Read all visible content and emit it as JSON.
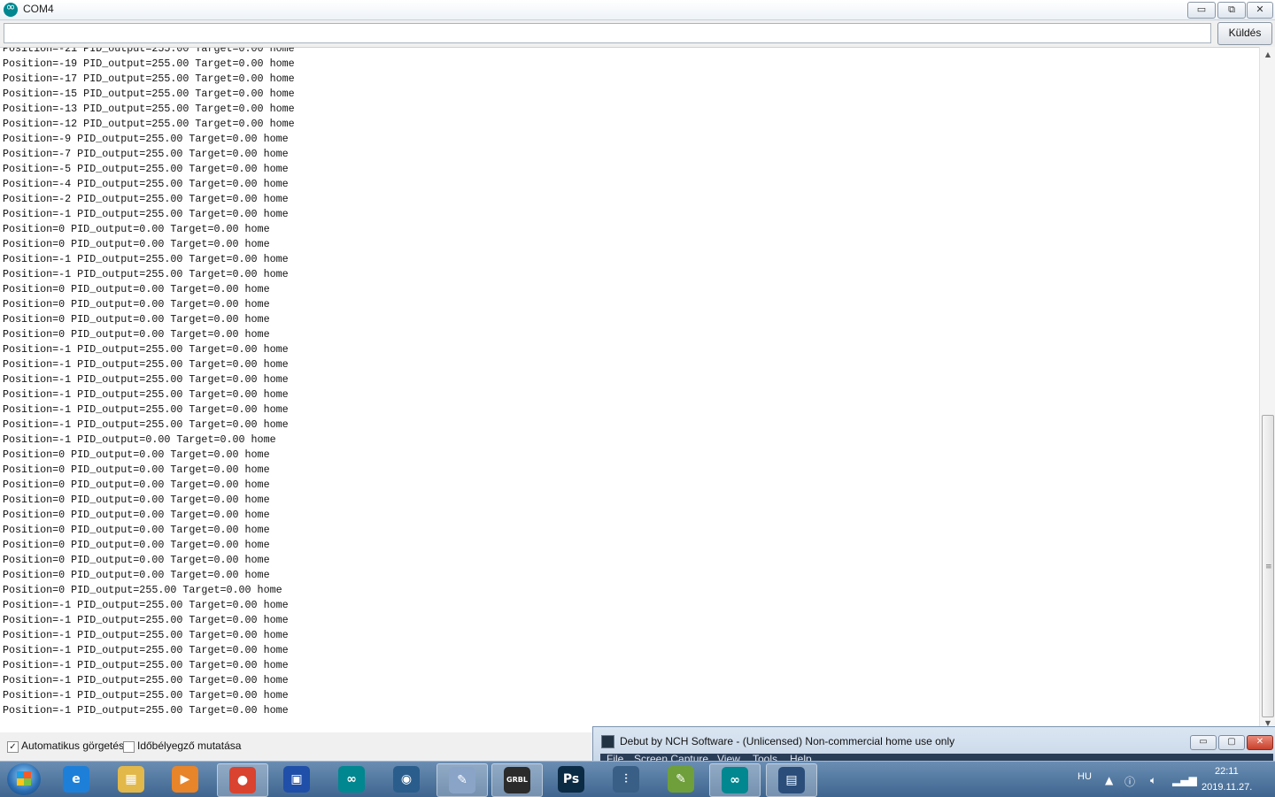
{
  "window": {
    "title": "COM4",
    "minimize": "▭",
    "maximize": "⧉",
    "close": "✕"
  },
  "send": {
    "input_value": "",
    "button_label": "Küldés"
  },
  "serial_lines": [
    "Position=-21 PID_output=255.00 Target=0.00 home",
    "Position=-19 PID_output=255.00 Target=0.00 home",
    "Position=-17 PID_output=255.00 Target=0.00 home",
    "Position=-15 PID_output=255.00 Target=0.00 home",
    "Position=-13 PID_output=255.00 Target=0.00 home",
    "Position=-12 PID_output=255.00 Target=0.00 home",
    "Position=-9 PID_output=255.00 Target=0.00 home",
    "Position=-7 PID_output=255.00 Target=0.00 home",
    "Position=-5 PID_output=255.00 Target=0.00 home",
    "Position=-4 PID_output=255.00 Target=0.00 home",
    "Position=-2 PID_output=255.00 Target=0.00 home",
    "Position=-1 PID_output=255.00 Target=0.00 home",
    "Position=0 PID_output=0.00 Target=0.00 home",
    "Position=0 PID_output=0.00 Target=0.00 home",
    "Position=-1 PID_output=255.00 Target=0.00 home",
    "Position=-1 PID_output=255.00 Target=0.00 home",
    "Position=0 PID_output=0.00 Target=0.00 home",
    "Position=0 PID_output=0.00 Target=0.00 home",
    "Position=0 PID_output=0.00 Target=0.00 home",
    "Position=0 PID_output=0.00 Target=0.00 home",
    "Position=-1 PID_output=255.00 Target=0.00 home",
    "Position=-1 PID_output=255.00 Target=0.00 home",
    "Position=-1 PID_output=255.00 Target=0.00 home",
    "Position=-1 PID_output=255.00 Target=0.00 home",
    "Position=-1 PID_output=255.00 Target=0.00 home",
    "Position=-1 PID_output=255.00 Target=0.00 home",
    "Position=-1 PID_output=0.00 Target=0.00 home",
    "Position=0 PID_output=0.00 Target=0.00 home",
    "Position=0 PID_output=0.00 Target=0.00 home",
    "Position=0 PID_output=0.00 Target=0.00 home",
    "Position=0 PID_output=0.00 Target=0.00 home",
    "Position=0 PID_output=0.00 Target=0.00 home",
    "Position=0 PID_output=0.00 Target=0.00 home",
    "Position=0 PID_output=0.00 Target=0.00 home",
    "Position=0 PID_output=0.00 Target=0.00 home",
    "Position=0 PID_output=0.00 Target=0.00 home",
    "Position=0 PID_output=255.00 Target=0.00 home",
    "Position=-1 PID_output=255.00 Target=0.00 home",
    "Position=-1 PID_output=255.00 Target=0.00 home",
    "Position=-1 PID_output=255.00 Target=0.00 home",
    "Position=-1 PID_output=255.00 Target=0.00 home",
    "Position=-1 PID_output=255.00 Target=0.00 home",
    "Position=-1 PID_output=255.00 Target=0.00 home",
    "Position=-1 PID_output=255.00 Target=0.00 home",
    "Position=-1 PID_output=255.00 Target=0.00 home"
  ],
  "scrollbar": {
    "position": 0.9
  },
  "status": {
    "autoscroll_label": "Automatikus görgetés",
    "autoscroll_checked": true,
    "autoscroll_mark": "✓",
    "timestamp_label": "Időbélyegző mutatása",
    "timestamp_checked": false
  },
  "debut": {
    "title": "Debut by NCH Software - (Unlicensed) Non-commercial home use only",
    "menu": [
      "File",
      "Screen Capture",
      "View",
      "Tools",
      "Help"
    ],
    "minimize": "▭",
    "maximize": "▢",
    "close": "✕"
  },
  "taskbar": {
    "apps": [
      {
        "name": "internet-explorer",
        "glyph": "e",
        "color": "#1e7fd8",
        "active": false
      },
      {
        "name": "file-explorer",
        "glyph": "▦",
        "color": "#e2b84a",
        "active": false
      },
      {
        "name": "media-player",
        "glyph": "▶",
        "color": "#e8842a",
        "active": false
      },
      {
        "name": "chrome",
        "glyph": "●",
        "color": "#d9432f",
        "active": true
      },
      {
        "name": "save-app",
        "glyph": "▣",
        "color": "#1f4fa8",
        "active": false
      },
      {
        "name": "arduino",
        "glyph": "∞",
        "color": "#00878f",
        "active": false
      },
      {
        "name": "webcam",
        "glyph": "◉",
        "color": "#2a5d8c",
        "active": false
      },
      {
        "name": "paint",
        "glyph": "✎",
        "color": "#8aa4c8",
        "active": true
      },
      {
        "name": "grbl-laser",
        "glyph": "GRBL",
        "color": "#2b2b2b",
        "active": true
      },
      {
        "name": "photoshop",
        "glyph": "Ps",
        "color": "#0b2a44",
        "active": false
      },
      {
        "name": "mixer",
        "glyph": "⫶",
        "color": "#3a5f86",
        "active": false
      },
      {
        "name": "notepad-plus",
        "glyph": "✎",
        "color": "#6f9f3a",
        "active": false
      },
      {
        "name": "arduino-active",
        "glyph": "∞",
        "color": "#00878f",
        "active": true
      },
      {
        "name": "debut",
        "glyph": "▤",
        "color": "#2a4d7a",
        "active": true
      }
    ],
    "language": "HU",
    "time": "22:11",
    "date": "2019.11.27."
  }
}
